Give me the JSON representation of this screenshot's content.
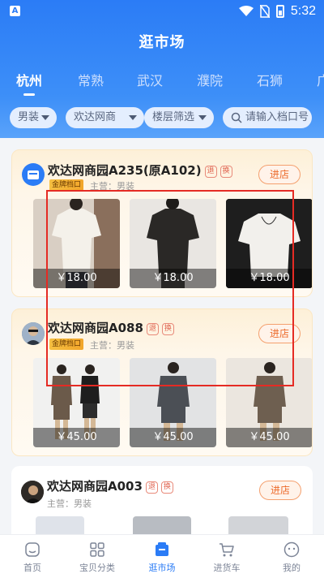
{
  "status_bar": {
    "time": "5:32",
    "app_icon_letter": "A"
  },
  "header": {
    "title": "逛市场"
  },
  "city_tabs": [
    {
      "label": "杭州",
      "active": true
    },
    {
      "label": "常熟",
      "active": false
    },
    {
      "label": "武汉",
      "active": false
    },
    {
      "label": "濮院",
      "active": false
    },
    {
      "label": "石狮",
      "active": false
    },
    {
      "label": "广",
      "active": false
    }
  ],
  "filters": {
    "gender": "男装",
    "market": "欢达网商",
    "floor": "楼层筛选",
    "search_placeholder": "请输入档口号"
  },
  "shops": [
    {
      "name": "欢达网商园A235(原A102)",
      "return_tag": "退",
      "exchange_tag": "换",
      "gold_badge": "金牌档口",
      "main_category": "主营：男装",
      "enter_label": "进店",
      "products": [
        {
          "price": "￥18.00"
        },
        {
          "price": "￥18.00"
        },
        {
          "price": "￥18.00"
        }
      ]
    },
    {
      "name": "欢达网商园A088",
      "return_tag": "退",
      "exchange_tag": "换",
      "gold_badge": "金牌档口",
      "main_category": "主营：男装",
      "enter_label": "进店",
      "products": [
        {
          "price": "￥45.00"
        },
        {
          "price": "￥45.00"
        },
        {
          "price": "￥45.00"
        }
      ]
    },
    {
      "name": "欢达网商园A003",
      "return_tag": "退",
      "exchange_tag": "换",
      "main_category": "主营：男装",
      "enter_label": "进店"
    }
  ],
  "bottom_nav": [
    {
      "label": "首页",
      "icon": "home-icon",
      "active": false
    },
    {
      "label": "宝贝分类",
      "icon": "grid-icon",
      "active": false
    },
    {
      "label": "逛市场",
      "icon": "market-icon",
      "active": true
    },
    {
      "label": "进货车",
      "icon": "cart-icon",
      "active": false
    },
    {
      "label": "我的",
      "icon": "profile-icon",
      "active": false
    }
  ],
  "colors": {
    "primary": "#2b7cf6",
    "accent_orange": "#ec6a2a",
    "highlight_red": "#e52b24"
  }
}
